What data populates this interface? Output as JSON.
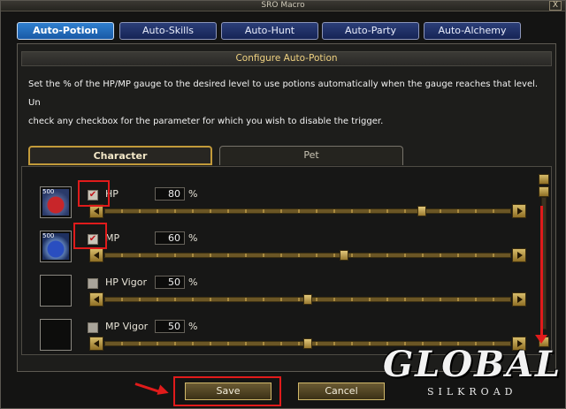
{
  "window": {
    "title": "SRO Macro",
    "close_glyph": "X"
  },
  "tabs": [
    {
      "label": "Auto-Potion",
      "active": true
    },
    {
      "label": "Auto-Skills",
      "active": false
    },
    {
      "label": "Auto-Hunt",
      "active": false
    },
    {
      "label": "Auto-Party",
      "active": false
    },
    {
      "label": "Auto-Alchemy",
      "active": false
    }
  ],
  "panel": {
    "title": "Configure Auto-Potion",
    "description_line1": "Set the % of the HP/MP gauge to the desired level to use potions automatically when the gauge reaches that level. Un",
    "description_line2": "check any checkbox for the parameter for which you wish to disable the trigger."
  },
  "subtabs": [
    {
      "label": "Character",
      "active": true
    },
    {
      "label": "Pet",
      "active": false
    }
  ],
  "rows": [
    {
      "label": "HP",
      "value": "80",
      "unit": "%",
      "checked": true,
      "check_glyph": "✔",
      "icon_badge": "500",
      "slider_fraction": 0.78
    },
    {
      "label": "MP",
      "value": "60",
      "unit": "%",
      "checked": true,
      "check_glyph": "✔",
      "icon_badge": "500",
      "slider_fraction": 0.59
    },
    {
      "label": "HP Vigor",
      "value": "50",
      "unit": "%",
      "checked": false,
      "check_glyph": "",
      "icon_badge": "",
      "slider_fraction": 0.5
    },
    {
      "label": "MP Vigor",
      "value": "50",
      "unit": "%",
      "checked": false,
      "check_glyph": "",
      "icon_badge": "",
      "slider_fraction": 0.5
    }
  ],
  "buttons": {
    "save": "Save",
    "cancel": "Cancel"
  },
  "logo": {
    "main": "GLOBAL",
    "sub": "SILKROAD"
  },
  "colors": {
    "highlight": "#e01b1b",
    "active_tab": "#1f6bbd",
    "gold": "#c29a3a"
  }
}
